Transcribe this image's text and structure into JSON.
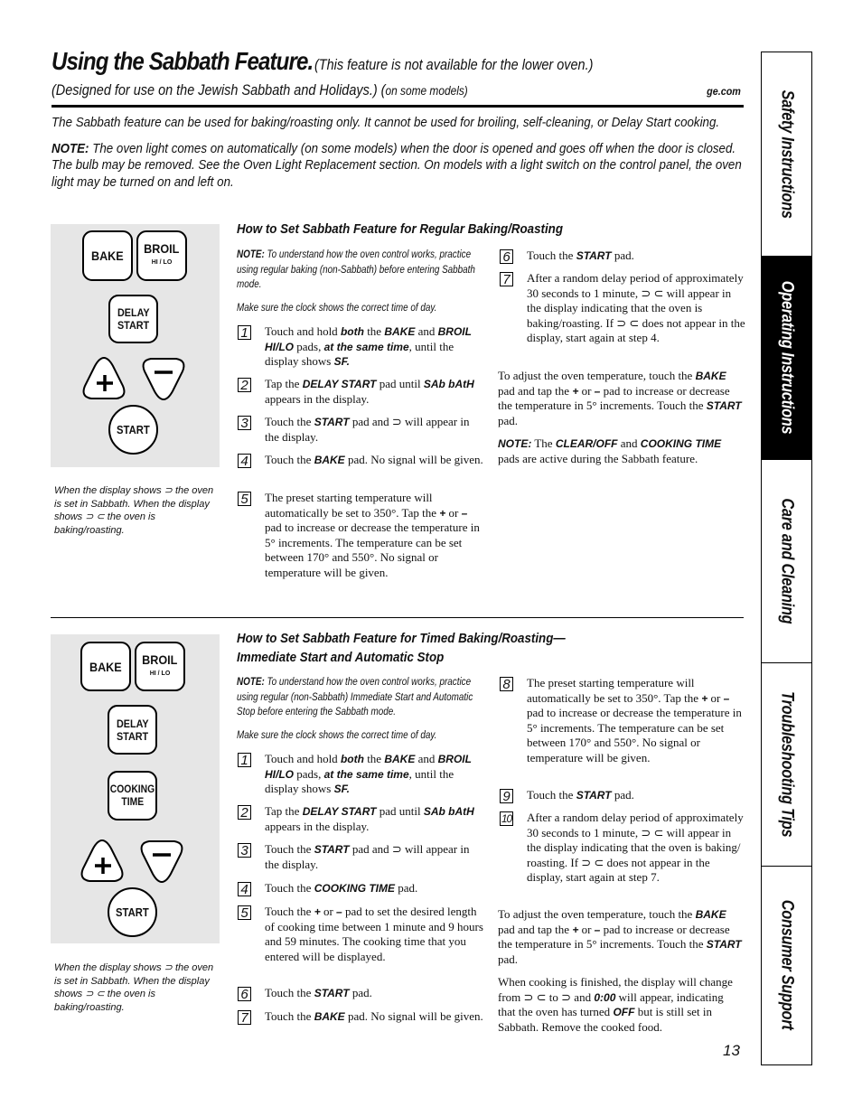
{
  "header": {
    "title": "Using the Sabbath Feature.",
    "subtitle": "(This feature is not available for the lower oven.)",
    "line2": "(Designed for use on the Jewish Sabbath and Holidays.) (",
    "line2_small": "on some models)",
    "site": "ge.com"
  },
  "intro": {
    "p1": "The Sabbath feature can be used for baking/roasting only. It cannot be used for broiling, self-cleaning, or Delay Start cooking.",
    "note_label": "NOTE:",
    "note_text": " The oven light comes on automatically (on some models) when the door is opened and goes off when the door is closed. The bulb may be removed. See the Oven Light Replacement section. On models with a light switch on the control panel, the oven light may be turned on and left on."
  },
  "side_tabs": [
    {
      "label": "Safety Instructions",
      "active": false
    },
    {
      "label": "Operating Instructions",
      "active": true
    },
    {
      "label": "Care and Cleaning",
      "active": false
    },
    {
      "label": "Troubleshooting Tips",
      "active": false
    },
    {
      "label": "Consumer Support",
      "active": false
    }
  ],
  "keys": {
    "bake": "BAKE",
    "broil": "BROIL",
    "broil_sub": "HI / LO",
    "delay1": "DELAY",
    "delay2": "START",
    "cooking1": "COOKING",
    "cooking2": "TIME",
    "start": "START"
  },
  "caption": "When the display shows ⊃ the oven is set in Sabbath. When the display shows ⊃ ⊂  the oven is baking/roasting.",
  "section1": {
    "heading": "How to Set Sabbath Feature for Regular Baking/Roasting",
    "note_label": "NOTE:",
    "note_text": " To understand how the oven control works, practice using regular baking (non-Sabbath) before entering Sabbath mode.",
    "clock": "Make sure the clock shows the correct time of day.",
    "steps": [
      {
        "n": "1",
        "html": "Touch and hold <span class='em'>both</span> the <span class='em'>BAKE</span> and <span class='em'>BROIL HI/LO</span> pads, <span class='em'>at the same time</span>, until the display shows <span class='em'>SF.</span>"
      },
      {
        "n": "2",
        "html": "Tap the <span class='em'>DELAY START</span> pad until <span class='em'>SAb bAtH</span> appears in the display."
      },
      {
        "n": "3",
        "html": "Touch the <span class='em'>START</span> pad and ⊃ will appear in the display."
      },
      {
        "n": "4",
        "html": "Touch the <span class='em'>BAKE</span> pad. No signal will be given."
      },
      {
        "n": "5",
        "html": "The preset starting temperature will automatically be set to 350°. Tap the <span class='em'>+</span> or <span class='em'>–</span> pad to increase or decrease the temperature in 5° increments. The temperature can be set between 170° and 550°. No signal or temperature will be given."
      },
      {
        "n": "6",
        "html": "Touch the <span class='em'>START</span> pad."
      },
      {
        "n": "7",
        "html": "After a random delay period of approximately 30 seconds to 1 minute, ⊃ ⊂ will appear in the display indicating that the oven is baking/roasting. If ⊃ ⊂ does not appear in the display, start again at step 4."
      }
    ],
    "adjust": "To adjust the oven temperature, touch the <span class='em'>BAKE</span> pad and tap the <span class='em'>+</span> or <span class='em'>–</span> pad to increase or decrease the temperature in 5° increments. Touch the <span class='em'>START</span> pad.",
    "note2": "<span class='em'>NOTE:</span> The <span class='em'>CLEAR/OFF</span> and <span class='em'>COOKING TIME</span> pads are active during the Sabbath feature."
  },
  "section2": {
    "heading1": "How to Set Sabbath Feature for Timed Baking/Roasting—",
    "heading2": "Immediate Start and Automatic Stop",
    "note_label": "NOTE:",
    "note_text": " To understand how the oven control works, practice using regular (non-Sabbath) Immediate Start and Automatic Stop before entering the Sabbath mode.",
    "clock": "Make sure the clock shows the correct time of day.",
    "steps": [
      {
        "n": "1",
        "html": "Touch and hold <span class='em'>both</span> the <span class='em'>BAKE</span> and <span class='em'>BROIL HI/LO</span> pads, <span class='em'>at the same time</span>, until the display shows <span class='em'>SF.</span>"
      },
      {
        "n": "2",
        "html": "Tap the <span class='em'>DELAY START</span> pad until <span class='em'>SAb bAtH</span> appears in the display."
      },
      {
        "n": "3",
        "html": "Touch the <span class='em'>START</span> pad and ⊃ will appear in the display."
      },
      {
        "n": "4",
        "html": "Touch the <span class='em'>COOKING TIME</span> pad."
      },
      {
        "n": "5",
        "html": "Touch the <span class='em'>+</span> or <span class='em'>–</span> pad to set the desired length of cooking time between 1 minute and 9 hours and 59 minutes. The cooking time that you entered will be displayed."
      },
      {
        "n": "6",
        "html": "Touch the <span class='em'>START</span> pad."
      },
      {
        "n": "7",
        "html": "Touch the <span class='em'>BAKE</span> pad. No signal will be given."
      },
      {
        "n": "8",
        "html": "The preset starting temperature will automatically be set to 350°. Tap the <span class='em'>+</span> or <span class='em'>–</span> pad to increase or decrease the temperature in 5° increments. The temperature can be set between 170° and 550°. No signal or temperature will be given."
      },
      {
        "n": "9",
        "html": "Touch the <span class='em'>START</span> pad."
      },
      {
        "n": "10",
        "html": "After a random delay period of approximately 30 seconds to 1 minute, ⊃ ⊂ will appear in the display indicating that the oven is baking/ roasting. If ⊃ ⊂ does not appear in the display, start again at step 7."
      }
    ],
    "adjust": "To adjust the oven temperature, touch the <span class='em'>BAKE</span> pad and tap the <span class='em'>+</span> or <span class='em'>–</span> pad to increase or decrease the temperature in 5° increments. Touch the <span class='em'>START</span> pad.",
    "finished": "When cooking is finished, the display will change from ⊃ ⊂ to ⊃ and <span class='em'>0:00</span> will appear, indicating that the oven has turned <span class='em'>OFF</span> but is still set in Sabbath. Remove the cooked food."
  },
  "page_number": "13"
}
